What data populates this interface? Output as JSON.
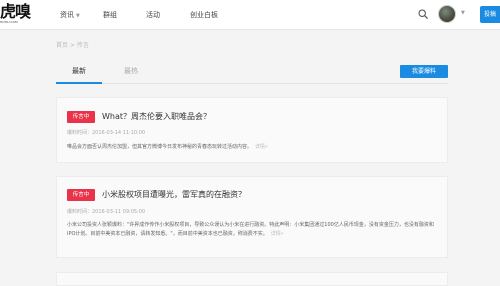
{
  "header": {
    "logo_text": "虎嗅",
    "logo_domain": "HUXIU.COM",
    "nav": [
      {
        "label": "资讯",
        "has_dropdown": true
      },
      {
        "label": "群组",
        "has_dropdown": false
      },
      {
        "label": "活动",
        "has_dropdown": false
      },
      {
        "label": "创业白板",
        "has_dropdown": false
      }
    ],
    "icons": {
      "search": "search-icon",
      "avatar": "user-avatar",
      "caret": "chevron-down-icon"
    },
    "right_button_label": "投稿"
  },
  "breadcrumb": "首页 > 传言",
  "tabs": [
    {
      "label": "最新",
      "active": true
    },
    {
      "label": "最热",
      "active": false
    }
  ],
  "report_button_label": "我要爆料",
  "posts": [
    {
      "badge": "传言中",
      "title": "What？周杰伦要入职唯品会？",
      "time": "爆料时间：2016-03-14 11:10:00",
      "summary": "唯品会方面否认周杰伦加盟，但其官方微博今日发布神秘的青春态玩转过活动内容。",
      "more": "详情»"
    },
    {
      "badge": "传言中",
      "title": "小米股权项目遭曝光，雷军真的在融资？",
      "time": "爆料时间：2016-03-11 09:05:00",
      "summary": "小米公司投资人张颖爆料：\"许昇成作传作小米股权项目，导致公众误认为小米在进行融资。特此声明：小米集团通过100亿人民币现金，没有资金压力，也没有融资和IPO计划。目前中美资本已融资，请转发知悉。\"，而目前中美资本也已融资，称消费不实。",
      "more": "详情»"
    }
  ],
  "colors": {
    "accent": "#1a8be0",
    "badge": "#e8334a",
    "background": "#f4f4f4"
  }
}
